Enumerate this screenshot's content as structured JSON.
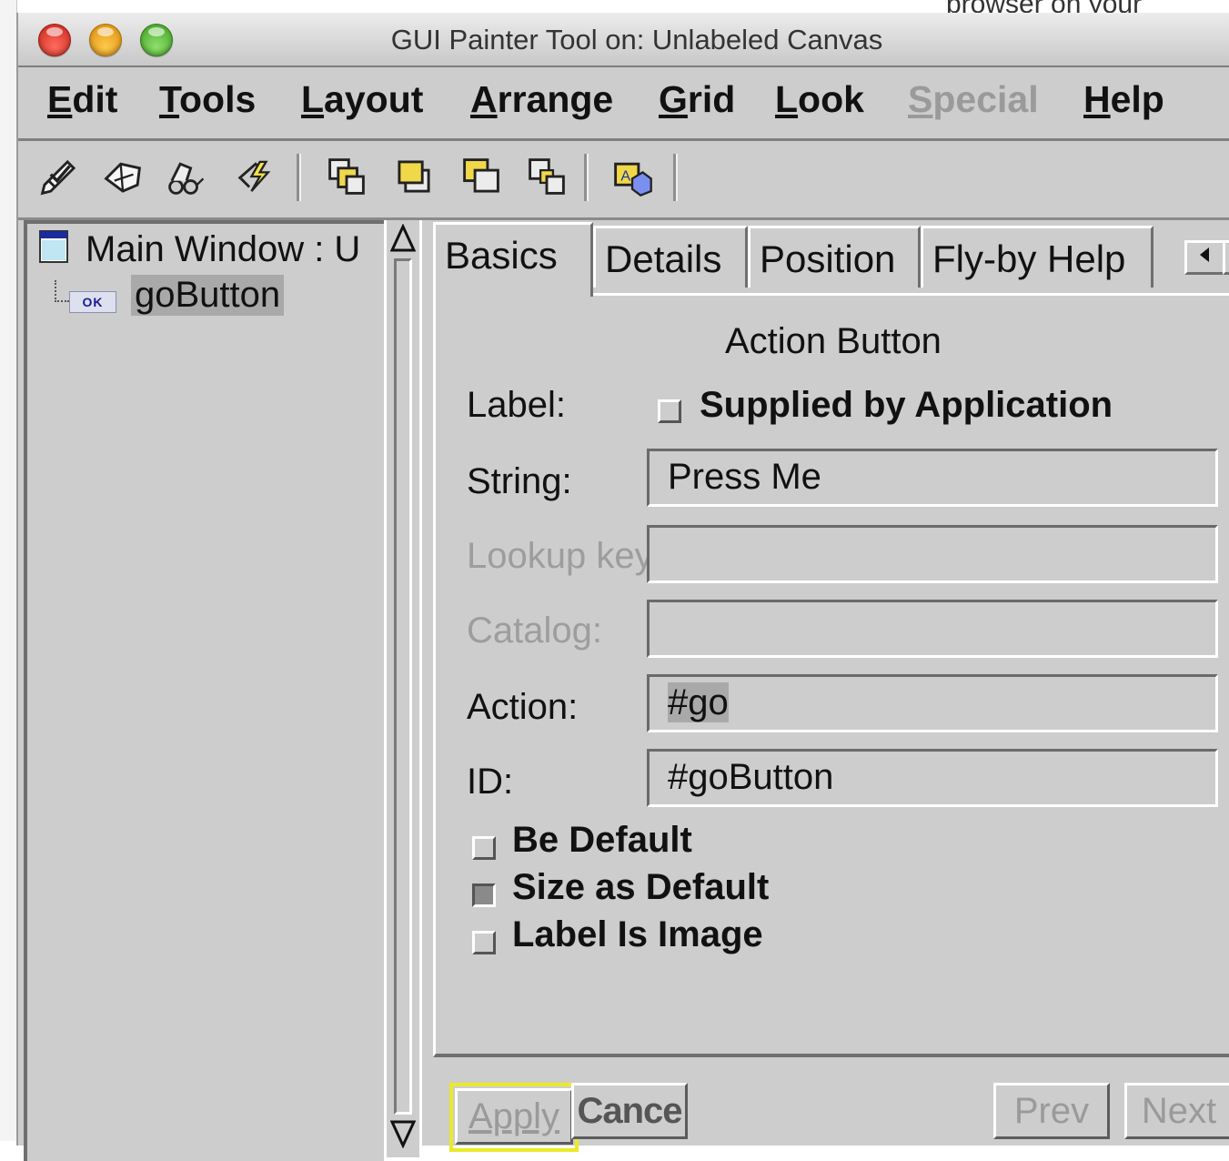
{
  "background": {
    "window_text": "browser on your"
  },
  "window": {
    "title": "GUI Painter Tool on: Unlabeled Canvas"
  },
  "menubar": {
    "items": [
      {
        "label": "Edit",
        "enabled": true
      },
      {
        "label": "Tools",
        "enabled": true
      },
      {
        "label": "Layout",
        "enabled": true
      },
      {
        "label": "Arrange",
        "enabled": true
      },
      {
        "label": "Grid",
        "enabled": true
      },
      {
        "label": "Look",
        "enabled": true
      },
      {
        "label": "Special",
        "enabled": false
      },
      {
        "label": "Help",
        "enabled": true
      }
    ]
  },
  "toolbar": {
    "tools": [
      "checkmark-pencil-icon",
      "eraser-icon",
      "glasses-icon",
      "lightning-check-icon",
      "bring-forward-icon",
      "send-backward-icon",
      "bring-to-front-icon",
      "send-to-back-icon",
      "shapes-icon"
    ]
  },
  "tree": {
    "root": "Main Window : U",
    "child_badge": "OK",
    "child": "goButton"
  },
  "tabs": [
    {
      "label": "Basics",
      "active": true
    },
    {
      "label": "Details",
      "active": false
    },
    {
      "label": "Position",
      "active": false
    },
    {
      "label": "Fly-by Help",
      "active": false
    }
  ],
  "properties": {
    "title": "Action Button",
    "label_label": "Label:",
    "supplied_by_app": {
      "label": "Supplied by Application",
      "checked": false
    },
    "string": {
      "label": "String:",
      "value": "Press Me"
    },
    "lookup_key": {
      "label": "Lookup key:",
      "value": "",
      "enabled": false
    },
    "catalog": {
      "label": "Catalog:",
      "value": "",
      "enabled": false
    },
    "action": {
      "label": "Action:",
      "value": "#go"
    },
    "id": {
      "label": "ID:",
      "value": "#goButton"
    },
    "options": [
      {
        "label": "Be Default",
        "checked": false
      },
      {
        "label": "Size as Default",
        "checked": true
      },
      {
        "label": "Label Is Image",
        "checked": false
      }
    ]
  },
  "buttons": {
    "apply": "Apply",
    "cancel": "Cance",
    "prev": "Prev",
    "next": "Next"
  },
  "colors": {
    "window_bg": "#cdcdcd",
    "selection": "#a9a9a9",
    "focus_ring": "#eaea2a",
    "disabled_text": "#9d9d9d"
  }
}
